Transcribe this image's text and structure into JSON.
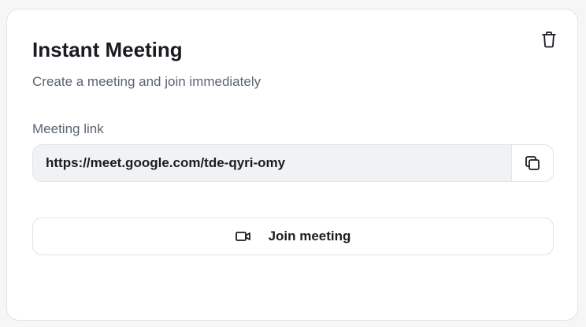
{
  "card": {
    "title": "Instant Meeting",
    "subtitle": "Create a meeting and join immediately"
  },
  "meeting_link": {
    "label": "Meeting link",
    "value": "https://meet.google.com/tde-qyri-omy"
  },
  "actions": {
    "join_label": "Join meeting"
  },
  "icons": {
    "delete": "trash-icon",
    "copy": "copy-icon",
    "video": "video-camera-icon"
  },
  "colors": {
    "text_primary": "#1b1c22",
    "text_secondary": "#5b6472",
    "border": "#e3e4e8",
    "input_bg": "#f1f2f4"
  }
}
